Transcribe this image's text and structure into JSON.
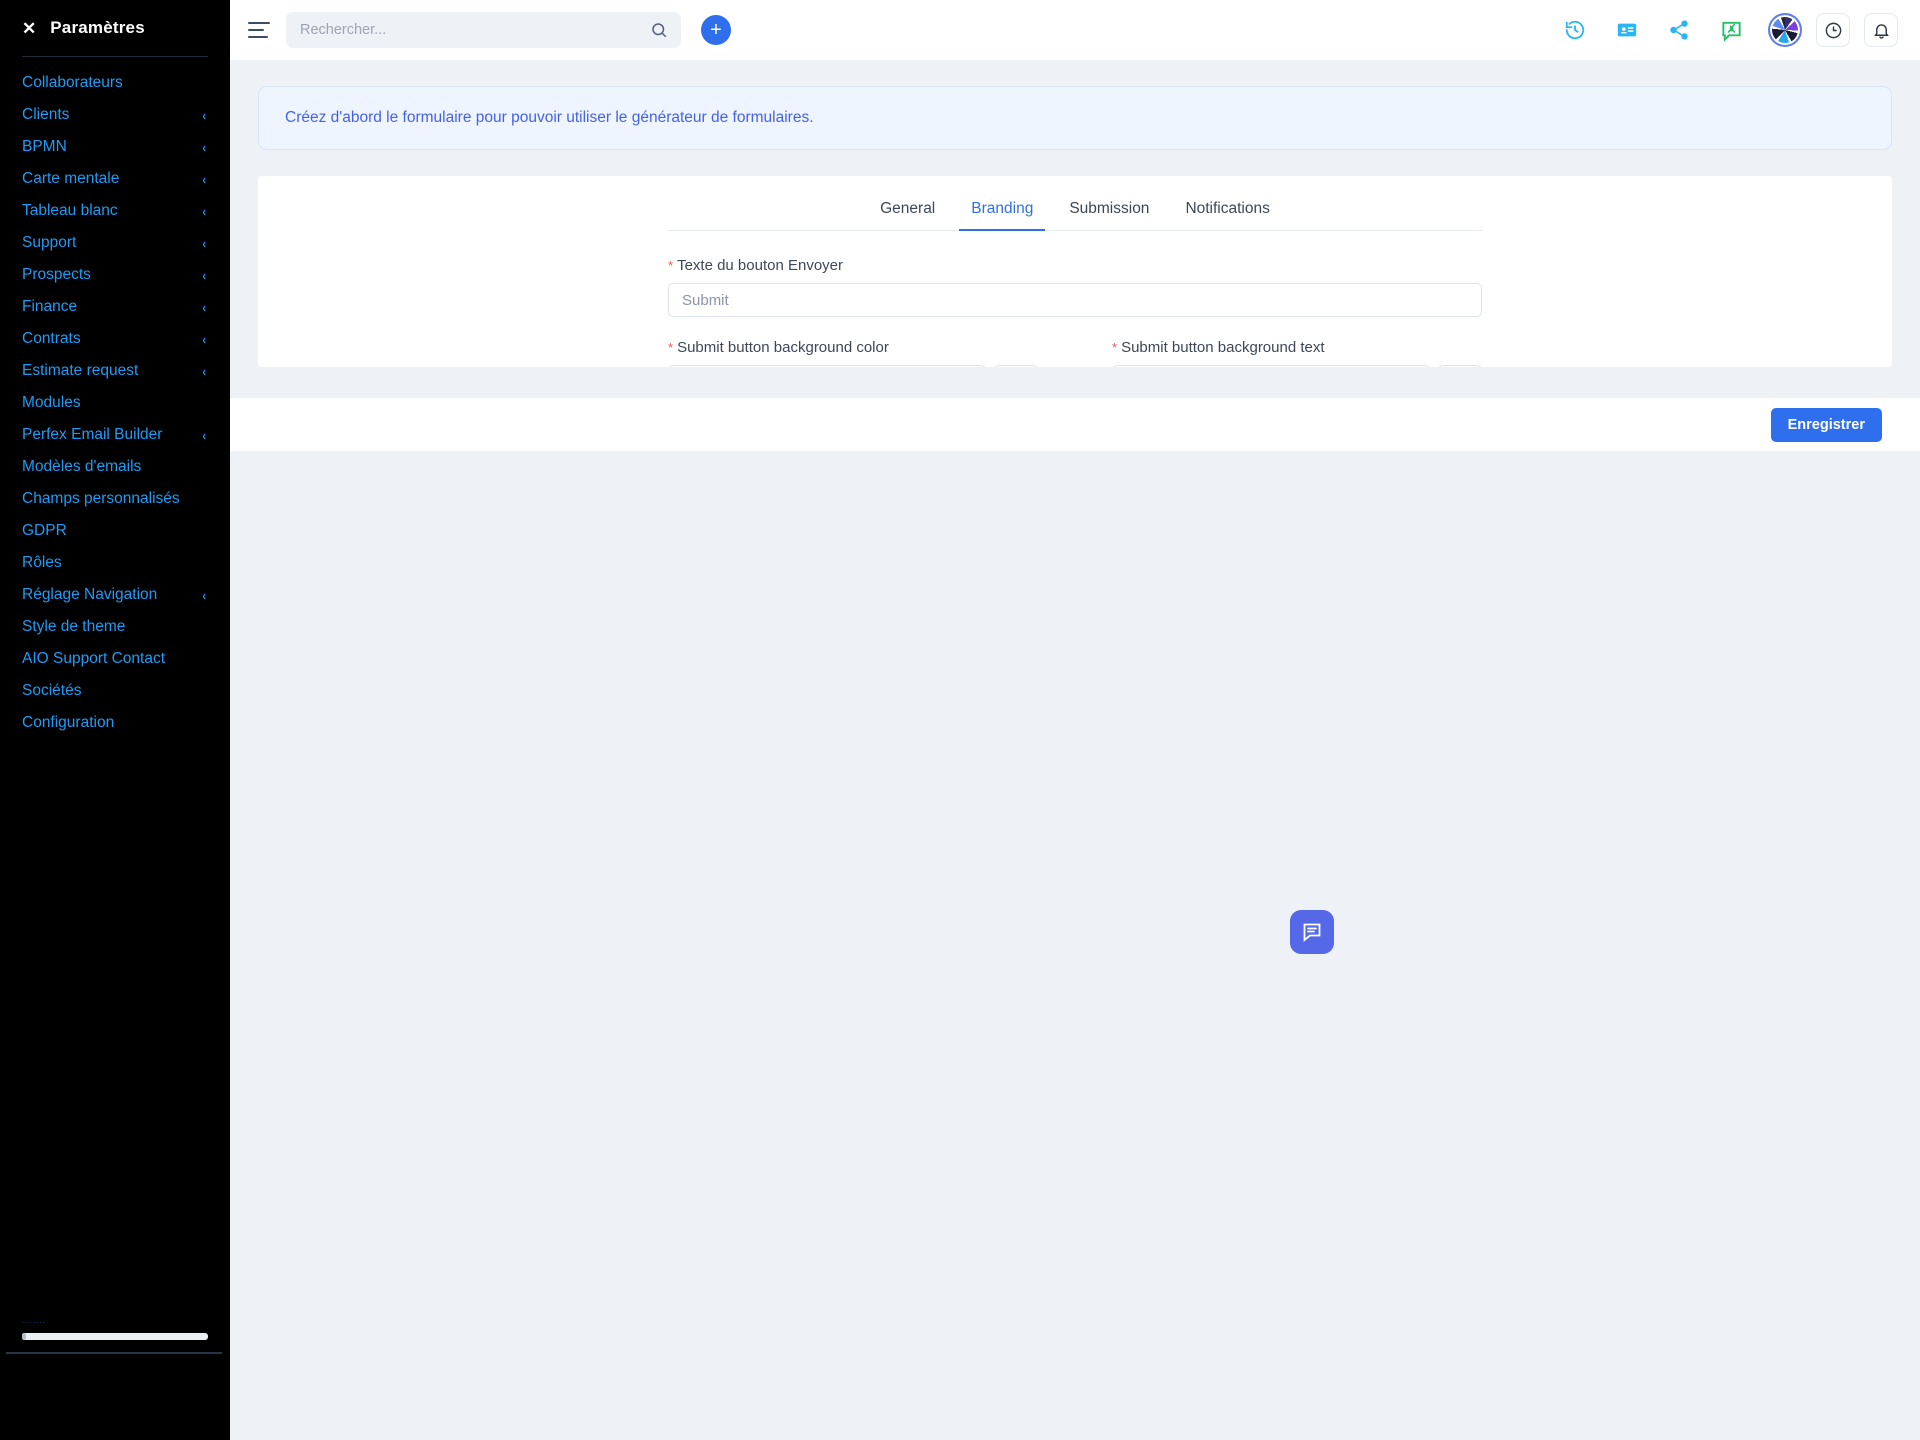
{
  "sidebar": {
    "close_label": "✕",
    "title": "Paramètres",
    "items": [
      {
        "label": "Collaborateurs",
        "caret": ""
      },
      {
        "label": "Clients",
        "caret": "‹"
      },
      {
        "label": "BPMN",
        "caret": "‹"
      },
      {
        "label": "Carte mentale",
        "caret": "‹"
      },
      {
        "label": "Tableau blanc",
        "caret": "‹"
      },
      {
        "label": "Support",
        "caret": "‹"
      },
      {
        "label": "Prospects",
        "caret": "‹"
      },
      {
        "label": "Finance",
        "caret": "‹"
      },
      {
        "label": "Contrats",
        "caret": "‹"
      },
      {
        "label": "Estimate request",
        "caret": "‹"
      },
      {
        "label": "Modules",
        "caret": ""
      },
      {
        "label": "Perfex Email Builder",
        "caret": "‹"
      },
      {
        "label": "Modèles d'emails",
        "caret": ""
      },
      {
        "label": "Champs personnalisés",
        "caret": ""
      },
      {
        "label": "GDPR",
        "caret": ""
      },
      {
        "label": "Rôles",
        "caret": ""
      },
      {
        "label": "Réglage Navigation",
        "caret": "‹"
      },
      {
        "label": "Style de theme",
        "caret": ""
      },
      {
        "label": "AIO Support Contact",
        "caret": ""
      },
      {
        "label": "Sociétés",
        "caret": ""
      },
      {
        "label": "Configuration",
        "caret": ""
      }
    ],
    "footer_label": "........"
  },
  "topbar": {
    "menu_icon": "hamburger-icon",
    "search": {
      "placeholder": "Rechercher...",
      "value": ""
    },
    "add_label": "+",
    "icons": [
      "history-icon",
      "contact-card-icon",
      "share-icon",
      "chat-approval-icon"
    ],
    "avatar": "user-avatar",
    "clock_icon": "clock-icon",
    "bell_icon": "bell-icon"
  },
  "main": {
    "banner_text": "Créez d'abord le formulaire pour pouvoir utiliser le générateur de formulaires.",
    "tabs": [
      {
        "label": "General",
        "active": false
      },
      {
        "label": "Branding",
        "active": true
      },
      {
        "label": "Submission",
        "active": false
      },
      {
        "label": "Notifications",
        "active": false
      }
    ],
    "fields": {
      "submit_button_text": {
        "label": "Texte du bouton Envoyer",
        "required_mark": "*",
        "placeholder": "Submit",
        "value": ""
      },
      "submit_bg_color": {
        "label": "Submit button background color",
        "required_mark": "*",
        "value": ""
      },
      "submit_bg_text": {
        "label": "Submit button background text",
        "required_mark": "*",
        "value": ""
      }
    },
    "save_label": "Enregistrer",
    "chat_fab": "chat-bubble-icon"
  },
  "colors": {
    "accent": "#2f6fed",
    "sidebar_bg": "#000000",
    "sidebar_link": "#1e9cf5",
    "banner_bg": "#eff5fe",
    "banner_text": "#4561e8",
    "page_bg": "#eef2f7"
  }
}
